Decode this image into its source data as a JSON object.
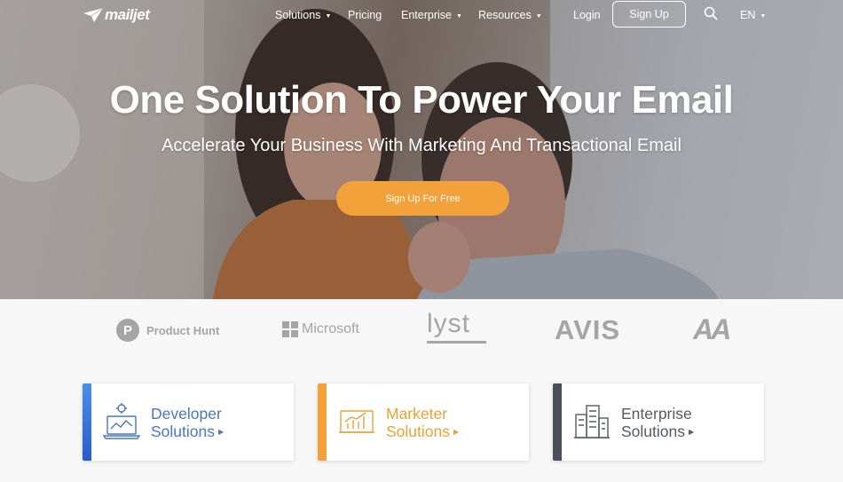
{
  "nav": {
    "logo": "mailjet",
    "items": [
      {
        "label": "Solutions",
        "caret": true
      },
      {
        "label": "Pricing",
        "caret": false
      },
      {
        "label": "Enterprise",
        "caret": true
      },
      {
        "label": "Resources",
        "caret": true
      }
    ],
    "login": "Login",
    "signup": "Sign Up",
    "language": "EN"
  },
  "hero": {
    "title": "One Solution To Power Your Email",
    "subtitle": "Accelerate Your Business With Marketing And Transactional Email",
    "cta": "Sign Up For Free"
  },
  "brands": {
    "product_hunt": "Product Hunt",
    "microsoft": "Microsoft",
    "lyst": "lyst",
    "avis": "AVIS",
    "aa": "AA"
  },
  "cards": [
    {
      "line1": "Developer",
      "line2": "Solutions",
      "color": "#3a7bd5",
      "text_color": "#4a78b8"
    },
    {
      "line1": "Marketer",
      "line2": "Solutions",
      "color": "#f3a13a",
      "text_color": "#e9a23a"
    },
    {
      "line1": "Enterprise",
      "line2": "Solutions",
      "color": "#4a4f5a",
      "text_color": "#555a63"
    }
  ],
  "colors": {
    "accent": "#f3a13a",
    "brand_gray": "#a5a5a5"
  }
}
